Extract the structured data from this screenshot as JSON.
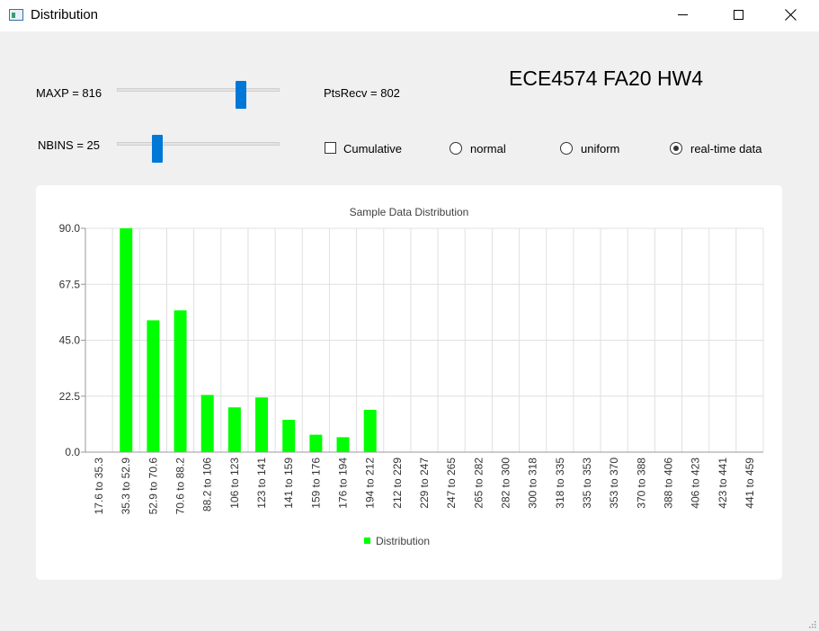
{
  "window": {
    "title": "Distribution",
    "icons": {
      "app": "app-icon",
      "minimize": "minimize-icon",
      "maximize": "maximize-icon",
      "close": "close-icon"
    }
  },
  "controls": {
    "maxp_label": "MAXP = 816",
    "nbins_label": "NBINS = 25",
    "pts_recv_label": "PtsRecv = 802",
    "heading": "ECE4574 FA20 HW4",
    "maxp_slider_fraction": 0.78,
    "nbins_slider_fraction": 0.23,
    "cumulative_label": "Cumulative",
    "cumulative_checked": false,
    "radio_options": [
      {
        "label": "normal",
        "checked": false
      },
      {
        "label": "uniform",
        "checked": false
      },
      {
        "label": "real-time data",
        "checked": true
      }
    ]
  },
  "colors": {
    "accent": "#0078d7",
    "bar": "#00ff00",
    "grid": "#e0e0e0"
  },
  "chart_data": {
    "type": "bar",
    "title": "Sample Data Distribution",
    "xlabel": "",
    "ylabel": "",
    "categories": [
      "17.6 to 35.3",
      "35.3 to 52.9",
      "52.9 to 70.6",
      "70.6 to 88.2",
      "88.2 to 106",
      "106 to 123",
      "123 to 141",
      "141 to 159",
      "159 to 176",
      "176 to 194",
      "194 to 212",
      "212 to 229",
      "229 to 247",
      "247 to 265",
      "265 to 282",
      "282 to 300",
      "300 to 318",
      "318 to 335",
      "335 to 353",
      "353 to 370",
      "370 to 388",
      "388 to 406",
      "406 to 423",
      "423 to 441",
      "441 to 459"
    ],
    "series": [
      {
        "name": "Distribution",
        "values": [
          0,
          90,
          53,
          57,
          23,
          18,
          22,
          13,
          7,
          6,
          17,
          0,
          0,
          0,
          0,
          0,
          0,
          0,
          0,
          0,
          0,
          0,
          0,
          0,
          0
        ]
      }
    ],
    "ylim": [
      0,
      90
    ],
    "yticks": [
      "0.0",
      "22.5",
      "45.0",
      "67.5",
      "90.0"
    ],
    "grid": true,
    "legend_position": "bottom"
  }
}
